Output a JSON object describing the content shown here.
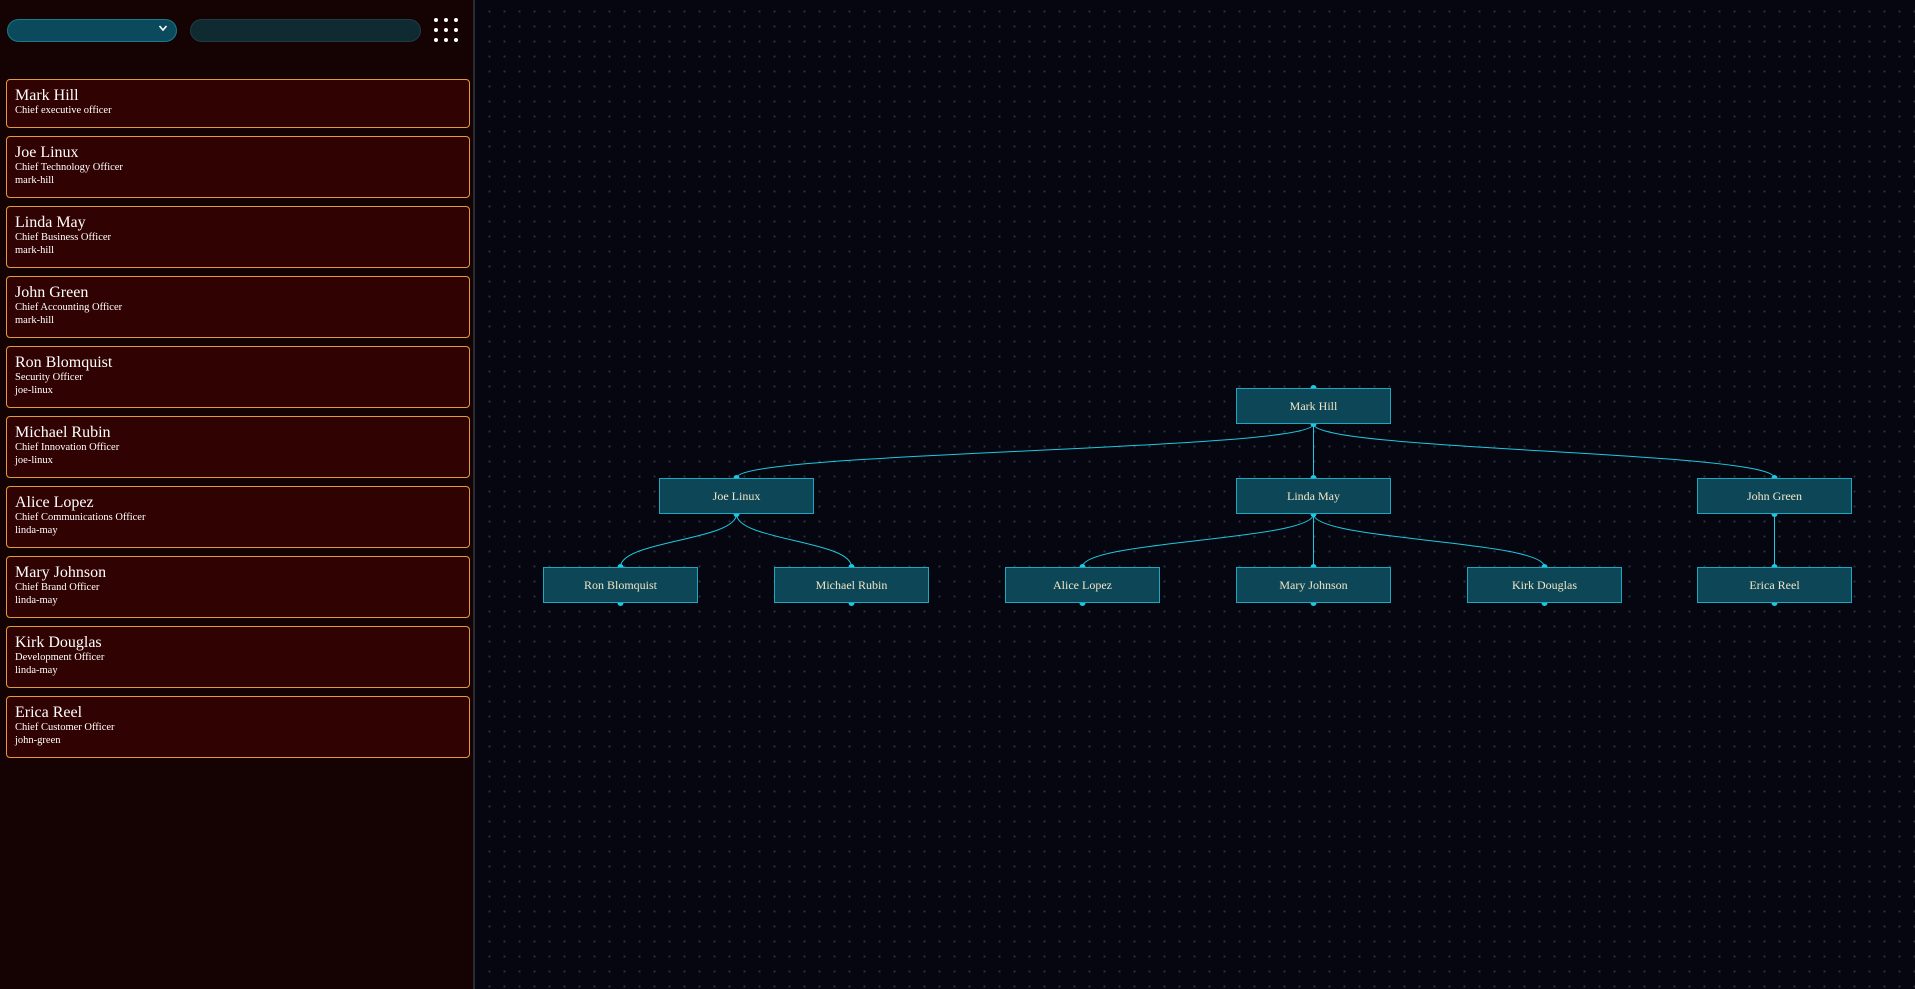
{
  "sidebar": {
    "select": {
      "value": "",
      "icon": "chevron-down-icon"
    },
    "search": {
      "placeholder": ""
    },
    "menu_icon": "grid-menu-icon",
    "cards": [
      {
        "id": "mark-hill",
        "name": "Mark Hill",
        "title": "Chief executive officer",
        "parent": ""
      },
      {
        "id": "joe-linux",
        "name": "Joe Linux",
        "title": "Chief Technology Officer",
        "parent": "mark-hill"
      },
      {
        "id": "linda-may",
        "name": "Linda May",
        "title": "Chief Business Officer",
        "parent": "mark-hill"
      },
      {
        "id": "john-green",
        "name": "John Green",
        "title": "Chief Accounting Officer",
        "parent": "mark-hill"
      },
      {
        "id": "ron-blomquist",
        "name": "Ron Blomquist",
        "title": "Security Officer",
        "parent": "joe-linux"
      },
      {
        "id": "michael-rubin",
        "name": "Michael Rubin",
        "title": "Chief Innovation Officer",
        "parent": "joe-linux"
      },
      {
        "id": "alice-lopez",
        "name": "Alice Lopez",
        "title": "Chief Communications Officer",
        "parent": "linda-may"
      },
      {
        "id": "mary-johnson",
        "name": "Mary Johnson",
        "title": "Chief Brand Officer",
        "parent": "linda-may"
      },
      {
        "id": "kirk-douglas",
        "name": "Kirk Douglas",
        "title": "Development Officer",
        "parent": "linda-may"
      },
      {
        "id": "erica-reel",
        "name": "Erica Reel",
        "title": "Chief Customer Officer",
        "parent": "john-green"
      }
    ]
  },
  "chart": {
    "nodes": [
      {
        "id": "mark-hill",
        "label": "Mark Hill"
      },
      {
        "id": "joe-linux",
        "label": "Joe Linux"
      },
      {
        "id": "linda-may",
        "label": "Linda May"
      },
      {
        "id": "john-green",
        "label": "John Green"
      },
      {
        "id": "ron-blomquist",
        "label": "Ron Blomquist"
      },
      {
        "id": "michael-rubin",
        "label": "Michael Rubin"
      },
      {
        "id": "alice-lopez",
        "label": "Alice Lopez"
      },
      {
        "id": "mary-johnson",
        "label": "Mary Johnson"
      },
      {
        "id": "kirk-douglas",
        "label": "Kirk Douglas"
      },
      {
        "id": "erica-reel",
        "label": "Erica Reel"
      }
    ],
    "edges": [
      [
        "mark-hill",
        "joe-linux"
      ],
      [
        "mark-hill",
        "linda-may"
      ],
      [
        "mark-hill",
        "john-green"
      ],
      [
        "joe-linux",
        "ron-blomquist"
      ],
      [
        "joe-linux",
        "michael-rubin"
      ],
      [
        "linda-may",
        "alice-lopez"
      ],
      [
        "linda-may",
        "mary-johnson"
      ],
      [
        "linda-may",
        "kirk-douglas"
      ],
      [
        "john-green",
        "erica-reel"
      ]
    ]
  },
  "colors": {
    "card_bg": "#310202",
    "card_border": "#e39a3b",
    "node_bg": "#0d4656",
    "node_border": "#1ea7c0",
    "link": "#1ec8e0",
    "node_text": "#f1e6c8"
  }
}
